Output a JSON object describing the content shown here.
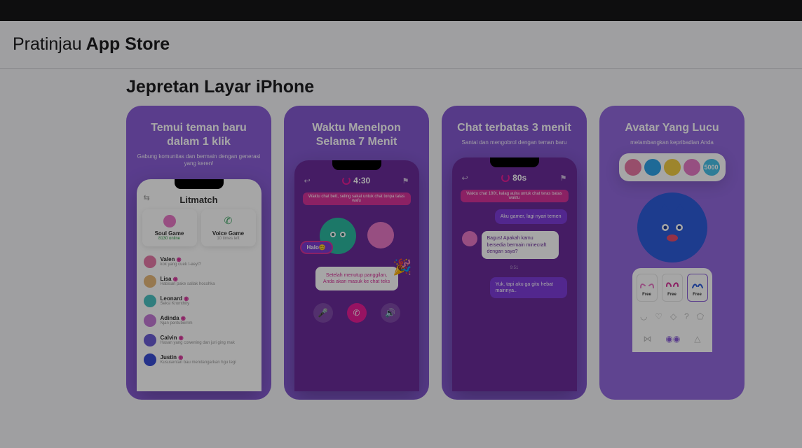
{
  "header": {
    "light": "Pratinjau",
    "bold": "App Store"
  },
  "section_title": "Jepretan Layar iPhone",
  "shots": [
    {
      "title_line1": "Temui teman baru",
      "title_line2": "dalam 1 klik",
      "subtitle": "Gabung komunitas dan bermain dengan generasi yang keren!",
      "app_name": "Litmatch",
      "cards": [
        {
          "label": "Soul Game",
          "sub": "8130 online"
        },
        {
          "label": "Voice Game",
          "sub": "10 times left"
        }
      ],
      "friends": [
        {
          "name": "Valen",
          "text": "kok yang cuek t-eeyt?",
          "color": "#e67aa8"
        },
        {
          "name": "Lisa",
          "text": "Habisan pake sallak hocohka",
          "color": "#e6b87a"
        },
        {
          "name": "Leonard",
          "text": "Seksi Kromthity",
          "color": "#4cc2c2"
        },
        {
          "name": "Adinda",
          "text": "Njan pentubernm",
          "color": "#c47ad6"
        },
        {
          "name": "Calvin",
          "text": "Hasan yang cowening dan juri ging mak",
          "color": "#6b5dd4"
        },
        {
          "name": "Justin",
          "text": "Kususentan bau mendangarkan hgu tegi",
          "color": "#3a4dd4"
        }
      ]
    },
    {
      "title_line1": "Waktu Menelpon",
      "title_line2": "Selama 7 Menit",
      "subtitle": "",
      "timer": "4:30",
      "halo": "Halo",
      "banner": "Waktu chat bett, seling sakat untuk chat tonpa tatas wafu",
      "tip": "Setelah menutup panggilan, Anda akan masuk ke chat teks"
    },
    {
      "title_line1": "Chat terbatas 3 menit",
      "title_line2": "",
      "subtitle": "Santai dan mengobrol dengan teman baru",
      "timer": "80s",
      "banner": "Waktu chat 180t, kalag aulra untuk chat teras batas waktu",
      "msgs": [
        {
          "text": "Aku gamer, lagi nyari temen",
          "mine": true
        },
        {
          "text": "Bagus! Apakah kamu bersedia bermain minecraft dengan saya?",
          "mine": false
        },
        {
          "text": "Yuk, tapi aku ga gitu hebat mainnya..",
          "mine": true
        }
      ],
      "ts": "9:51"
    },
    {
      "title_line1": "Avatar Yang Lucu",
      "title_line2": "",
      "subtitle": "melambangkan kepribadian Anda",
      "strip": [
        {
          "color": "#e879a5"
        },
        {
          "color": "#2ea3e8"
        },
        {
          "color": "#f2cc44"
        },
        {
          "color": "#e67ac6"
        },
        {
          "color": "#47c0e8",
          "label": "5000"
        }
      ],
      "items": [
        {
          "price": "Free"
        },
        {
          "price": "Free"
        },
        {
          "price": "Free",
          "selected": true
        }
      ]
    }
  ]
}
